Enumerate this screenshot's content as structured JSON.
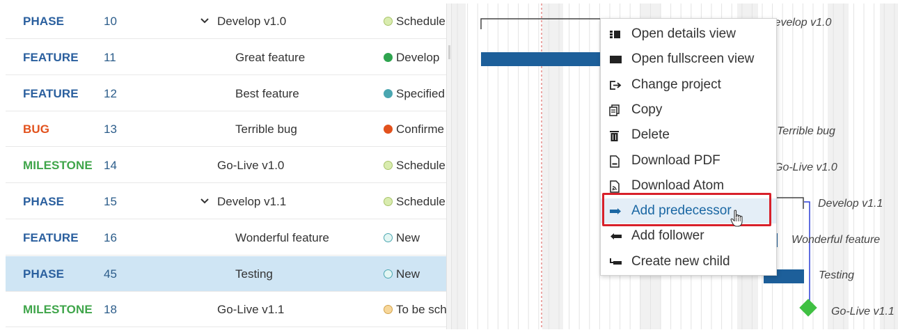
{
  "colors": {
    "phase": "#2a5f9e",
    "feature": "#2a5f9e",
    "bug": "#e2521d",
    "milestone": "#3fa54a",
    "selected_row": "#cfe5f4",
    "bar": "#1d5f9a",
    "link": "#2a3fd6",
    "highlight_box": "#d8202a",
    "today_line": "#d9534f"
  },
  "rows": [
    {
      "type": "PHASE",
      "id": "10",
      "subject": "Develop v1.0",
      "expandable": true,
      "indent": 0,
      "status": "Schedule",
      "status_color": "#d9ecaf",
      "type_color": "#2a5f9e"
    },
    {
      "type": "FEATURE",
      "id": "11",
      "subject": "Great feature",
      "expandable": false,
      "indent": 1,
      "status": "Develop",
      "status_color": "#2fa44f",
      "type_color": "#2a5f9e"
    },
    {
      "type": "FEATURE",
      "id": "12",
      "subject": "Best feature",
      "expandable": false,
      "indent": 1,
      "status": "Specified",
      "status_color": "#4aa6b0",
      "type_color": "#2a5f9e"
    },
    {
      "type": "BUG",
      "id": "13",
      "subject": "Terrible bug",
      "expandable": false,
      "indent": 1,
      "status": "Confirme",
      "status_color": "#e2521d",
      "type_color": "#e2521d"
    },
    {
      "type": "MILESTONE",
      "id": "14",
      "subject": "Go-Live v1.0",
      "expandable": false,
      "indent": 0,
      "status": "Schedule",
      "status_color": "#d9ecaf",
      "type_color": "#3fa54a"
    },
    {
      "type": "PHASE",
      "id": "15",
      "subject": "Develop v1.1",
      "expandable": true,
      "indent": 0,
      "status": "Schedule",
      "status_color": "#d9ecaf",
      "type_color": "#2a5f9e"
    },
    {
      "type": "FEATURE",
      "id": "16",
      "subject": "Wonderful feature",
      "expandable": false,
      "indent": 1,
      "status": "New",
      "status_color": "#e3f6f3",
      "type_color": "#2a5f9e"
    },
    {
      "type": "PHASE",
      "id": "45",
      "subject": "Testing",
      "expandable": false,
      "indent": 1,
      "status": "New",
      "status_color": "#e3f6f3",
      "type_color": "#2a5f9e",
      "selected": true
    },
    {
      "type": "MILESTONE",
      "id": "18",
      "subject": "Go-Live v1.1",
      "expandable": false,
      "indent": 0,
      "status": "To be sch",
      "status_color": "#f7d79a",
      "type_color": "#3fa54a"
    }
  ],
  "gantt": {
    "labels": [
      "Develop v1.0",
      "Terrible bug",
      "Go-Live v1.0",
      "Develop v1.1",
      "Wonderful feature",
      "Testing",
      "Go-Live v1.1"
    ]
  },
  "context_menu": {
    "items": [
      {
        "label": "Open details view",
        "icon": "details-view-icon"
      },
      {
        "label": "Open fullscreen view",
        "icon": "fullscreen-view-icon"
      },
      {
        "label": "Change project",
        "icon": "change-project-icon"
      },
      {
        "label": "Copy",
        "icon": "copy-icon"
      },
      {
        "label": "Delete",
        "icon": "delete-icon"
      },
      {
        "label": "Download PDF",
        "icon": "pdf-icon"
      },
      {
        "label": "Download Atom",
        "icon": "atom-feed-icon"
      },
      {
        "label": "Add predecessor",
        "icon": "add-predecessor-icon",
        "hovered": true
      },
      {
        "label": "Add follower",
        "icon": "add-follower-icon"
      },
      {
        "label": "Create new child",
        "icon": "create-child-icon"
      }
    ]
  }
}
